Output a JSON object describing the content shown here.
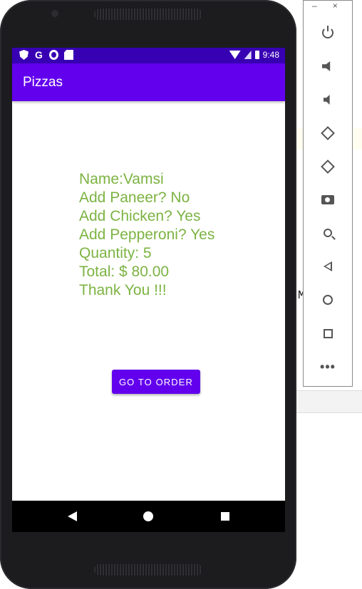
{
  "window_controls": {
    "minimize_label": "–",
    "close_label": "×"
  },
  "status_bar": {
    "time": "9:48",
    "g_label": "G"
  },
  "app_bar": {
    "title": "Pizzas"
  },
  "summary": {
    "name_line": "Name:Vamsi",
    "paneer_line": "Add Paneer? No",
    "chicken_line": "Add Chicken? Yes",
    "pepperoni_line": "Add Pepperoni? Yes",
    "quantity_line": "Quantity: 5",
    "total_line": "Total: $ 80.00",
    "thanks_line": "Thank You !!!"
  },
  "actions": {
    "go_to_order_label": "GO TO ORDER"
  },
  "colors": {
    "app_bar": "#6200ee",
    "status_bar": "#3700b3",
    "summary_text": "#7cb342",
    "button": "#6200ee"
  },
  "toolbar": {
    "icons": [
      "power-icon",
      "volume-up-icon",
      "volume-down-icon",
      "rotate-left-icon",
      "rotate-right-icon",
      "camera-icon",
      "zoom-icon",
      "back-icon",
      "home-icon",
      "overview-icon",
      "more-icon"
    ]
  },
  "background_editor": {
    "visible_text": "M  i"
  }
}
